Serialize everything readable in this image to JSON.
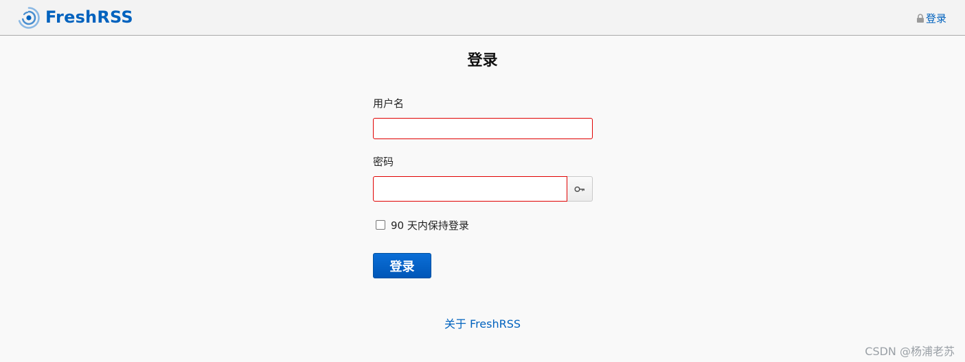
{
  "header": {
    "brand": "FreshRSS",
    "login_link": "登录"
  },
  "main": {
    "title": "登录",
    "username_label": "用户名",
    "username_value": "",
    "password_label": "密码",
    "password_value": "",
    "remember_label": "90 天内保持登录",
    "remember_checked": false,
    "submit_label": "登录",
    "about_link": "关于 FreshRSS"
  },
  "watermark": "CSDN @杨浦老苏",
  "colors": {
    "brand_blue": "#0062be",
    "invalid_border": "#e00000",
    "button_blue": "#0b6ed6"
  },
  "icons": {
    "logo": "freshrss-logo-icon",
    "lock": "lock-icon",
    "password_toggle": "key-icon"
  }
}
